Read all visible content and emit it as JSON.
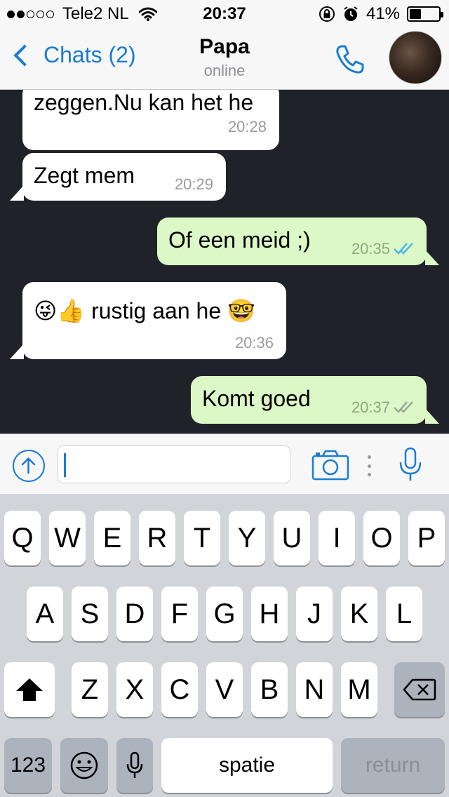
{
  "status_bar": {
    "carrier": "Tele2 NL",
    "time": "20:37",
    "battery": "41%",
    "battery_level": 0.41,
    "signal_bars_filled": 2,
    "signal_bars_total": 5
  },
  "header": {
    "back_label": "Chats (2)",
    "contact_name": "Papa",
    "contact_status": "online"
  },
  "messages": [
    {
      "direction": "in",
      "text": "zeggen.Nu kan het he",
      "time": "20:28"
    },
    {
      "direction": "in",
      "text": "Zegt mem",
      "time": "20:29"
    },
    {
      "direction": "out",
      "text": "Of een meid ;)",
      "time": "20:35",
      "status": "read"
    },
    {
      "direction": "in",
      "text": "😜👍 rustig aan he 🤓",
      "time": "20:36"
    },
    {
      "direction": "out",
      "text": "Komt goed",
      "time": "20:37",
      "status": "delivered"
    }
  ],
  "input": {
    "value": "",
    "placeholder": ""
  },
  "colors": {
    "accent": "#1a7bd5",
    "chat_background": "#20222a",
    "incoming_bubble": "#ffffff",
    "outgoing_bubble": "#dcf8c6",
    "read_ticks": "#4fb6ec",
    "delivered_ticks": "#9aa89a"
  },
  "icons": {
    "back": "chevron-left-icon",
    "call": "phone-icon",
    "upload": "arrow-up-circle-icon",
    "camera": "camera-icon",
    "more": "vertical-dots-icon",
    "mic": "microphone-icon",
    "shift": "shift-arrow-icon",
    "backspace": "backspace-icon",
    "emoji": "emoji-icon",
    "dictation": "microphone-icon"
  },
  "keyboard": {
    "row1": [
      "Q",
      "W",
      "E",
      "R",
      "T",
      "Y",
      "U",
      "I",
      "O",
      "P"
    ],
    "row2": [
      "A",
      "S",
      "D",
      "F",
      "G",
      "H",
      "J",
      "K",
      "L"
    ],
    "row3": [
      "Z",
      "X",
      "C",
      "V",
      "B",
      "N",
      "M"
    ],
    "numbers_label": "123",
    "space_label": "spatie",
    "return_label": "return"
  }
}
